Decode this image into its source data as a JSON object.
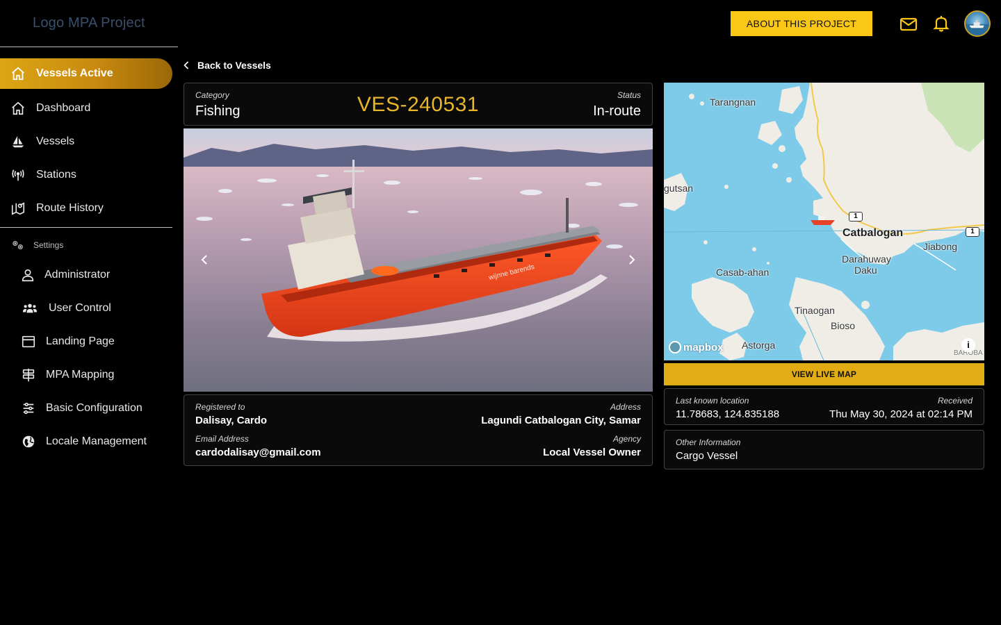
{
  "app": {
    "logo": "Logo MPA Project"
  },
  "sidebar": {
    "active_item": {
      "label": "Vessels Active",
      "icon": "home-icon"
    },
    "items": [
      {
        "label": "Dashboard",
        "icon": "home-icon"
      },
      {
        "label": "Vessels",
        "icon": "sailboat-icon"
      },
      {
        "label": "Stations",
        "icon": "antenna-icon"
      },
      {
        "label": "Route History",
        "icon": "map-pin-icon"
      }
    ],
    "settings_header": "Settings",
    "settings_items": [
      {
        "label": "Administrator",
        "icon": "user-icon"
      },
      {
        "label": "User Control",
        "icon": "users-icon"
      },
      {
        "label": "Landing Page",
        "icon": "window-icon"
      },
      {
        "label": "MPA Mapping",
        "icon": "signpost-icon"
      },
      {
        "label": "Basic Configuration",
        "icon": "sliders-icon"
      },
      {
        "label": "Locale Management",
        "icon": "globe-icon"
      }
    ]
  },
  "topbar": {
    "about_label": "ABOUT THIS PROJECT",
    "accent": "#fac717"
  },
  "back_label": "Back to Vessels",
  "vessel": {
    "category_label": "Category",
    "category": "Fishing",
    "id": "VES-240531",
    "status_label": "Status",
    "status": "In-route",
    "id_color": "#e8b62a"
  },
  "owner": {
    "registered_label": "Registered to",
    "registered": "Dalisay, Cardo",
    "email_label": "Email Address",
    "email": "cardodalisay@gmail.com",
    "address_label": "Address",
    "address": "Lagundi Catbalogan City, Samar",
    "agency_label": "Agency",
    "agency": "Local Vessel Owner"
  },
  "map": {
    "labels": {
      "tarangnan": "Tarangnan",
      "gutsan": "gutsan",
      "catbalogan": "Catbalogan",
      "jiabong": "Jiabong",
      "darahuway1": "Darahuway",
      "darahuway2": "Daku",
      "casab": "Casab-ahan",
      "tinaogan": "Tinaogan",
      "bioso": "Bioso",
      "astorga": "Astorga",
      "barob": "BAROBA"
    },
    "road_shield": "1",
    "attribution": "mapbox",
    "live_map_label": "VIEW LIVE MAP"
  },
  "location": {
    "last_label": "Last known location",
    "coords": "11.78683, 124.835188",
    "received_label": "Received",
    "received": "Thu May 30, 2024 at 02:14 PM"
  },
  "other": {
    "label": "Other Information",
    "value": "Cargo Vessel"
  }
}
